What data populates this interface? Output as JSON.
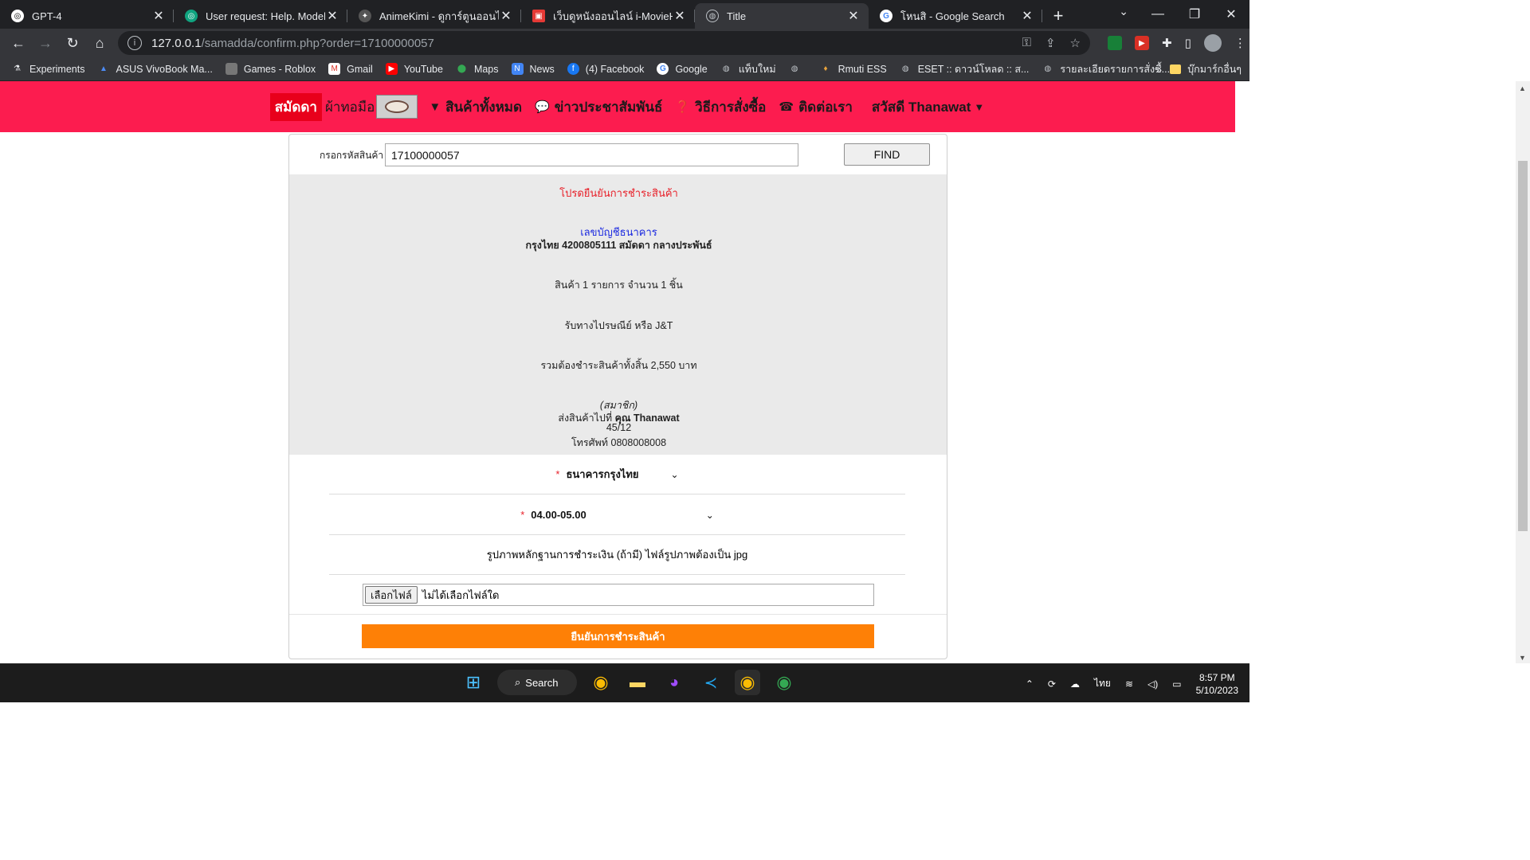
{
  "browser": {
    "tabs": [
      {
        "title": "GPT-4",
        "icon": "openai-icon",
        "active": false
      },
      {
        "title": "User request: Help. Model r",
        "icon": "chatgpt-icon",
        "active": false
      },
      {
        "title": "AnimeKimi - ดูการ์ตูนออนไลน์",
        "icon": "anime-icon",
        "active": false
      },
      {
        "title": "เว็บดูหนังออนไลน์ i-MovieHD u",
        "icon": "imovie-icon",
        "active": false
      },
      {
        "title": "Title",
        "icon": "globe-icon",
        "active": true
      },
      {
        "title": "โหนสิ - Google Search",
        "icon": "google-icon",
        "active": false
      }
    ],
    "address": {
      "host": "127.0.0.1",
      "path": "/samadda/confirm.php?order=17100000057"
    },
    "bookmarks": [
      {
        "label": "Experiments",
        "icon": "flask-icon"
      },
      {
        "label": "ASUS VivoBook Ma...",
        "icon": "asus-icon"
      },
      {
        "label": "Games - Roblox",
        "icon": "roblox-icon"
      },
      {
        "label": "Gmail",
        "icon": "gmail-icon"
      },
      {
        "label": "YouTube",
        "icon": "youtube-icon"
      },
      {
        "label": "Maps",
        "icon": "maps-icon"
      },
      {
        "label": "News",
        "icon": "news-icon"
      },
      {
        "label": "(4) Facebook",
        "icon": "facebook-icon"
      },
      {
        "label": "Google",
        "icon": "google-icon"
      },
      {
        "label": "แท็บใหม่",
        "icon": "globe-icon"
      },
      {
        "label": "",
        "icon": "globe-icon"
      },
      {
        "label": "Rmuti ESS",
        "icon": "rmuti-icon"
      },
      {
        "label": "ESET :: ดาวน์โหลด :: ส...",
        "icon": "globe-icon"
      },
      {
        "label": "รายละเอียดรายการสั่งซื้...",
        "icon": "globe-icon"
      }
    ],
    "bookmarks_more": "»",
    "bookmarks_folder": "บุ๊กมาร์กอื่นๆ"
  },
  "site": {
    "brand": "สมัดดา",
    "brand_sub": "ผ้าทอมือ",
    "nav": [
      {
        "label": "สินค้าทั้งหมด",
        "icon": "caret-down-icon"
      },
      {
        "label": "ข่าวประชาสัมพันธ์",
        "icon": "comments-icon"
      },
      {
        "label": "วิธีการสั่งซื้อ",
        "icon": "question-icon"
      },
      {
        "label": "ติดต่อเรา",
        "icon": "phone-icon"
      }
    ],
    "user_greeting": "สวัสดี Thanawat"
  },
  "find": {
    "label": "กรอกรหัสสินค้า",
    "value": "17100000057",
    "button": "FIND"
  },
  "order": {
    "heading": "โปรดยืนยันการชำระสินค้า",
    "bank_heading": "เลขบัญชีธนาคาร",
    "bank_account": "กรุงไทย 4200805111 สมัดดา กลางประพันธ์",
    "items": "สินค้า 1 รายการ จำนวน 1 ชิ้น",
    "shipping": "รับทางไปรษณีย์ หรือ J&T",
    "total": "รวมต้องชำระสินค้าทั้งสิ้น 2,550 บาท",
    "member": "(สมาชิก)",
    "ship_to_prefix": "ส่งสินค้าไปที่",
    "ship_to_name": "คุณ Thanawat",
    "address": "45/12",
    "phone": "โทรศัพท์ 0808008008"
  },
  "form": {
    "bank_select": "ธนาคารกรุงไทย",
    "time_select": "04.00-05.00",
    "slip_note": "รูปภาพหลักฐานการชำระเงิน (ถ้ามี) ไฟล์รูปภาพต้องเป็น jpg",
    "file_button": "เลือกไฟล์",
    "file_status": "ไม่ได้เลือกไฟล์ใด",
    "confirm_button": "ยืนยันการชำระสินค้า"
  },
  "taskbar": {
    "search_label": "Search",
    "language": "ไทย",
    "time": "8:57 PM",
    "date": "5/10/2023"
  }
}
